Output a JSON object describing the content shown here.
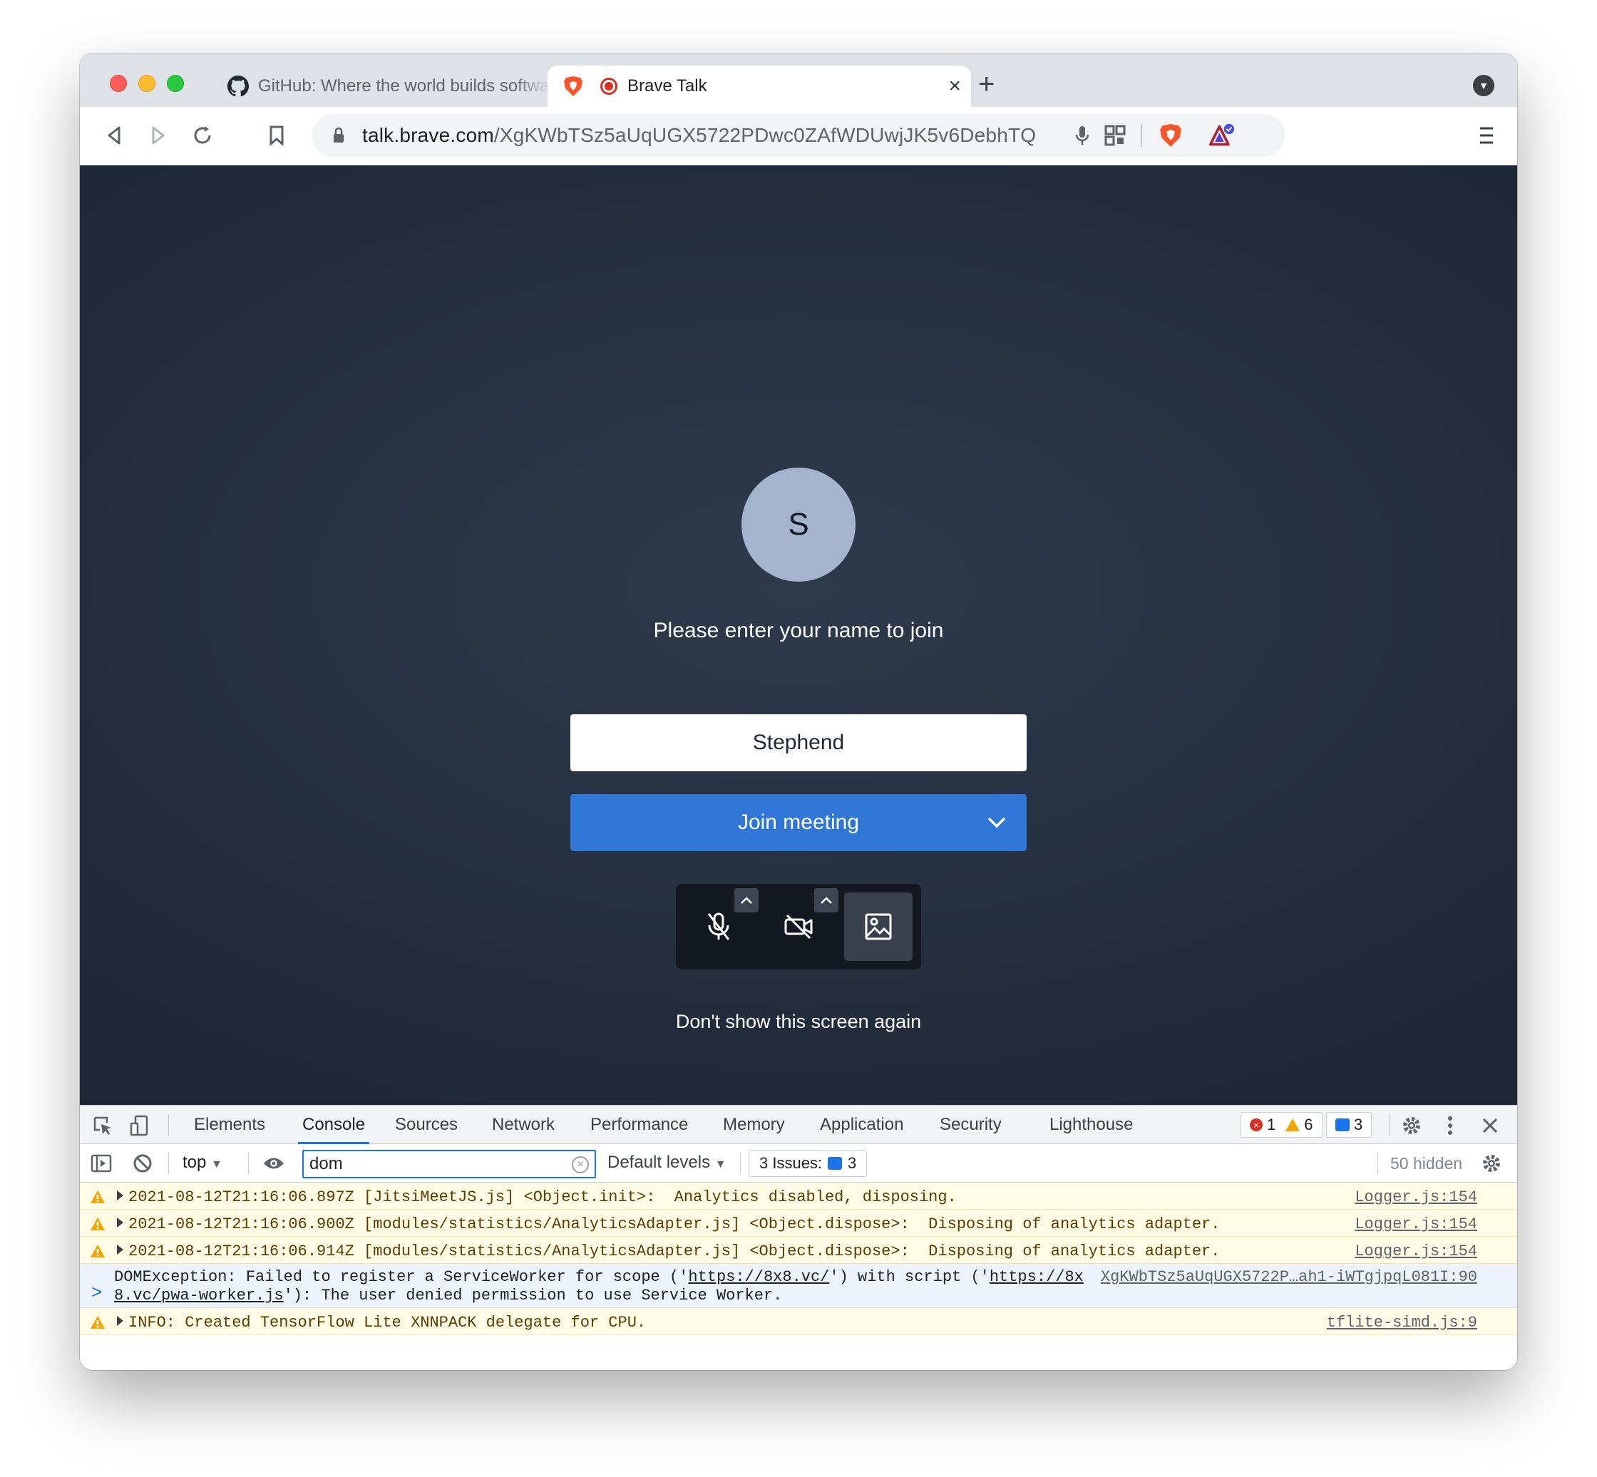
{
  "browser": {
    "tabs": [
      {
        "title": "GitHub: Where the world builds software",
        "icon": "github-icon",
        "active": false
      },
      {
        "title": "Brave Talk",
        "icon": "brave-icon",
        "active": true,
        "recording": true
      }
    ],
    "new_tab": "+",
    "url": {
      "host": "talk.brave.com",
      "path": "/XgKWbTSz5aUqUGX5722PDwc0ZAfWDUwjJK5v6DebhTQ"
    }
  },
  "page": {
    "avatar_initial": "S",
    "prompt": "Please enter your name to join",
    "name_value": "Stephend",
    "join_label": "Join meeting",
    "dont_show": "Don't show this screen again"
  },
  "devtools": {
    "tabs": [
      "Elements",
      "Console",
      "Sources",
      "Network",
      "Performance",
      "Memory",
      "Application",
      "Security",
      "Lighthouse"
    ],
    "active_tab": "Console",
    "counts": {
      "errors": "1",
      "warnings": "6",
      "messages": "3"
    },
    "context": "top",
    "filter_value": "dom",
    "levels": "Default levels",
    "issues_label": "3 Issues:",
    "issues_count": "3",
    "hidden": "50 hidden",
    "logs": [
      {
        "level": "warning",
        "text": "2021-08-12T21:16:06.897Z [JitsiMeetJS.js] <Object.init>:  Analytics disabled, disposing.",
        "source": "Logger.js:154"
      },
      {
        "level": "warning",
        "text": "2021-08-12T21:16:06.900Z [modules/statistics/AnalyticsAdapter.js] <Object.dispose>:  Disposing of analytics adapter.",
        "source": "Logger.js:154"
      },
      {
        "level": "warning",
        "text": "2021-08-12T21:16:06.914Z [modules/statistics/AnalyticsAdapter.js] <Object.dispose>:  Disposing of analytics adapter.",
        "source": "Logger.js:154"
      },
      {
        "level": "info",
        "line1_a": "DOMException: Failed to register a ServiceWorker for scope ('",
        "line1_link": "https://8x8.vc/",
        "line1_b": "') with script ('",
        "line1_link2": "https://8x",
        "line2_link": "8.vc/pwa-worker.js",
        "line2_b": "'): The user denied permission to use Service Worker.",
        "source": "XgKWbTSz5aUqUGX5722P…ah1-iWTgjpqL081I:90"
      },
      {
        "level": "warning",
        "text": "INFO: Created TensorFlow Lite XNNPACK delegate for CPU.",
        "source": "tflite-simd.js:9"
      }
    ],
    "prompt_symbol": ">"
  }
}
